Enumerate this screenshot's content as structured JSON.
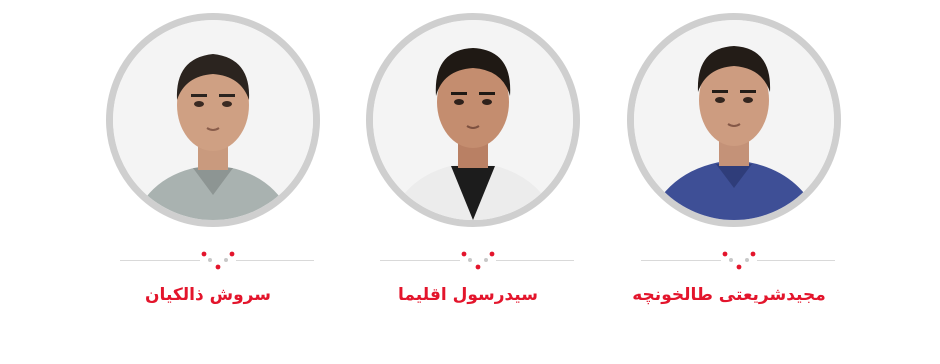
{
  "colors": {
    "accent": "#e3152c",
    "ring": "#cfcfcf",
    "divider": "#d9d9d9",
    "dot_gray": "#c8c8c8"
  },
  "people": [
    {
      "name": "سروش ذالکیان",
      "shirt_color": "#a9b2b0",
      "photo_icon": "portrait-photo"
    },
    {
      "name": "سیدرسول اقلیما",
      "shirt_color": "#ececec",
      "photo_icon": "portrait-photo"
    },
    {
      "name": "مجیدشریعتی طالخونچه",
      "shirt_color": "#3e4f96",
      "photo_icon": "portrait-photo"
    }
  ]
}
